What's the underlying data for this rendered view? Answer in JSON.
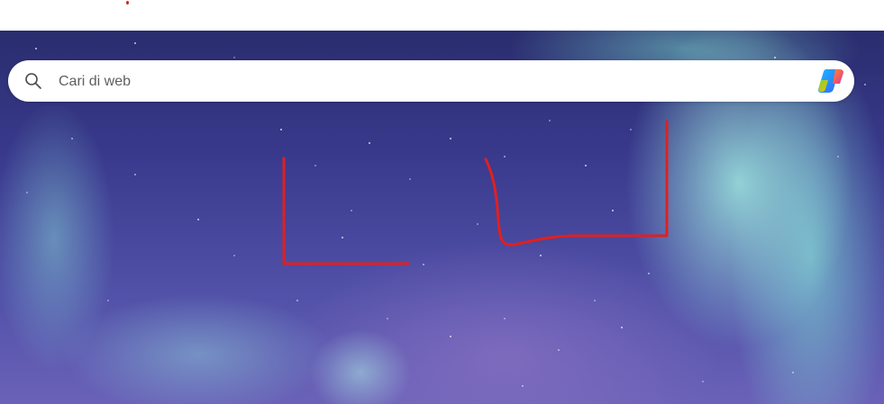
{
  "search": {
    "placeholder": "Cari di web",
    "value": ""
  },
  "icons": {
    "search": "search-icon",
    "copilot": "copilot-icon"
  },
  "colors": {
    "annotation_stroke": "#e02020",
    "search_bar_bg": "#ffffff",
    "wallpaper_top": "#2a2d6e",
    "aurora": "#a0ebe1"
  }
}
